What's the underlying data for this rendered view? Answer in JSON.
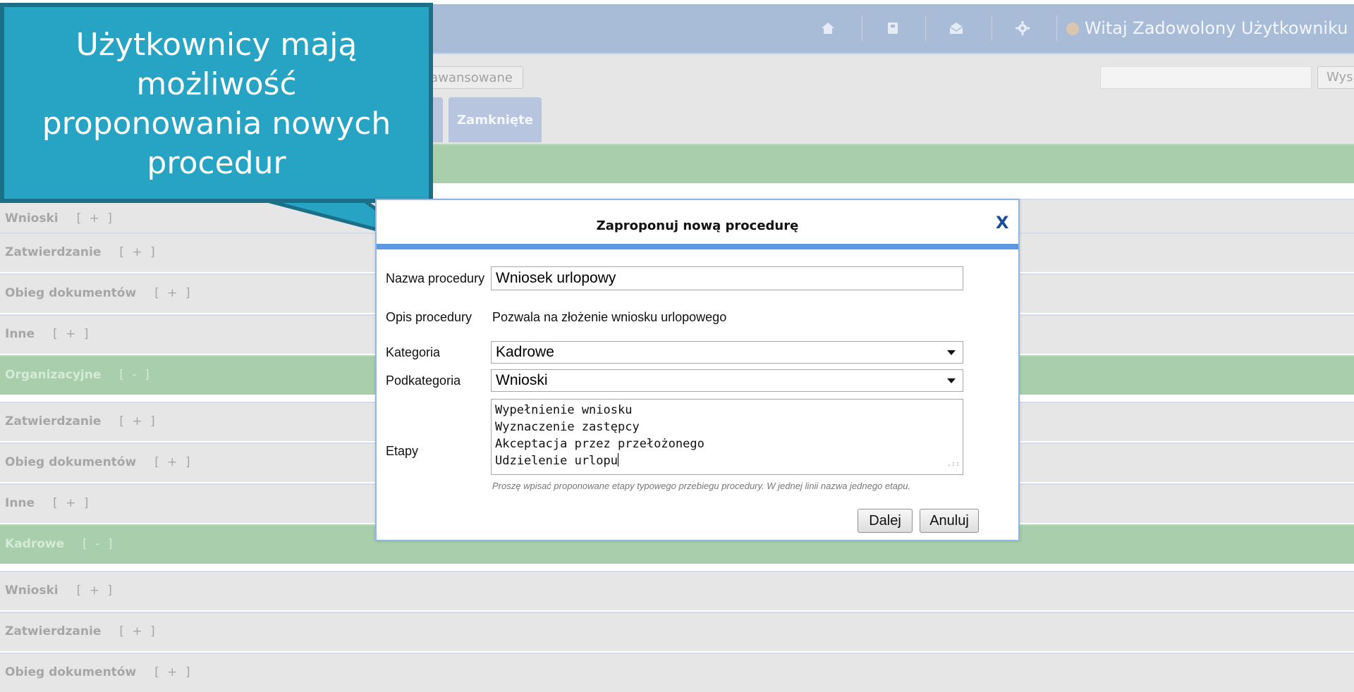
{
  "header": {
    "icons": [
      "home-icon",
      "book-icon",
      "mail-icon",
      "gear-icon"
    ],
    "welcome": "Witaj Zadowolony Użytkowniku"
  },
  "search": {
    "advanced_label": "awansowane",
    "search_label": "Wys",
    "query_value": ""
  },
  "tabs": [
    {
      "label": ""
    },
    {
      "label": "Zamknięte"
    }
  ],
  "rows": [
    {
      "label": "Wnioski",
      "toggle": "[ + ]",
      "type": "sub"
    },
    {
      "label": "Zatwierdzanie",
      "toggle": "[ + ]",
      "type": "sub"
    },
    {
      "label": "Obieg dokumentów",
      "toggle": "[ + ]",
      "type": "sub"
    },
    {
      "label": "Inne",
      "toggle": "[ + ]",
      "type": "sub"
    },
    {
      "label": "Organizacyjne",
      "toggle": "[ - ]",
      "type": "cat"
    },
    {
      "label": "Zatwierdzanie",
      "toggle": "[ + ]",
      "type": "sub"
    },
    {
      "label": "Obieg dokumentów",
      "toggle": "[ + ]",
      "type": "sub"
    },
    {
      "label": "Inne",
      "toggle": "[ + ]",
      "type": "sub"
    },
    {
      "label": "Kadrowe",
      "toggle": "[ - ]",
      "type": "cat"
    },
    {
      "label": "Wnioski",
      "toggle": "[ + ]",
      "type": "sub"
    },
    {
      "label": "Zatwierdzanie",
      "toggle": "[ + ]",
      "type": "sub"
    },
    {
      "label": "Obieg dokumentów",
      "toggle": "[ + ]",
      "type": "sub"
    }
  ],
  "callout": {
    "lines": [
      "Użytkownicy mają",
      "możliwość",
      "proponowania nowych",
      "procedur"
    ]
  },
  "dialog": {
    "title": "Zaproponuj nową procedurę",
    "close_label": "X",
    "name_label": "Nazwa procedury",
    "name_value": "Wniosek urlopowy",
    "desc_label": "Opis procedury",
    "desc_value": "Pozwala na złożenie wniosku urlopowego",
    "category_label": "Kategoria",
    "category_value": "Kadrowe",
    "subcategory_label": "Podkategoria",
    "subcategory_value": "Wnioski",
    "stages_label": "Etapy",
    "stages": [
      "Wypełnienie wniosku",
      "Wyznaczenie zastępcy",
      "Akceptacja przez przełożonego",
      "Udzielenie urlopu"
    ],
    "hint": "Proszę wpisać proponowane etapy typowego przebiegu procedury. W jednej linii nazwa jednego etapu.",
    "next_label": "Dalej",
    "cancel_label": "Anuluj"
  },
  "colors": {
    "topbar": "#a9bcd7",
    "category_row": "#a8ceab",
    "callout": "#27a3c3",
    "dialog_accent": "#5e98e3"
  }
}
